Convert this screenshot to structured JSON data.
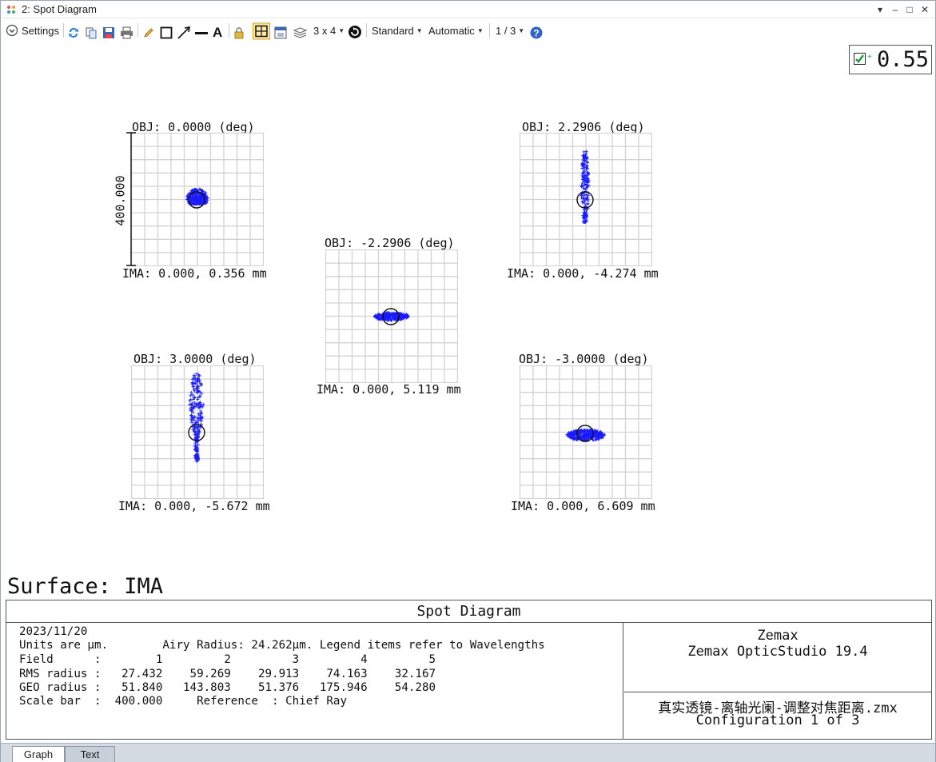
{
  "window": {
    "title": "2: Spot Diagram",
    "controls": [
      "▾",
      "–",
      "□",
      "✕"
    ]
  },
  "toolbar": {
    "settings_label": "Settings",
    "layout_label": "3 x 4",
    "standard_label": "Standard",
    "automatic_label": "Automatic",
    "page_label": "1 / 3"
  },
  "value_box": {
    "value": "0.55"
  },
  "surface_label": "Surface: IMA",
  "scale_bar_label": "400.000",
  "fields": [
    {
      "obj": "OBJ: 0.0000 (deg)",
      "ima": "IMA: 0.000, 0.356 mm",
      "spot": "blob"
    },
    {
      "obj": "OBJ: 2.2906 (deg)",
      "ima": "IMA: 0.000, -4.274 mm",
      "spot": "vertical"
    },
    {
      "obj": "OBJ: -2.2906 (deg)",
      "ima": "IMA: 0.000, 5.119 mm",
      "spot": "horizontal"
    },
    {
      "obj": "OBJ: 3.0000 (deg)",
      "ima": "IMA: 0.000, -5.672 mm",
      "spot": "vertical-long"
    },
    {
      "obj": "OBJ: -3.0000 (deg)",
      "ima": "IMA: 0.000, 6.609 mm",
      "spot": "horizontal-wide"
    }
  ],
  "info": {
    "title": "Spot Diagram",
    "date": "2023/11/20",
    "units_line": "Units are µm.        Airy Radius: 24.262µm. Legend items refer to Wavelengths",
    "field_line": "Field      :        1         2         3         4         5",
    "rms_line": "RMS radius :   27.432    59.269    29.913    74.163    32.167",
    "geo_line": "GEO radius :   51.840   143.803    51.376   175.946    54.280",
    "scale_line": "Scale bar  :  400.000     Reference  : Chief Ray",
    "company": "Zemax",
    "product": "Zemax OpticStudio 19.4",
    "filename": "真实透镜-离轴光阑-调整对焦距离.zmx",
    "configuration": "Configuration 1 of 3"
  },
  "tabs": [
    "Graph",
    "Text"
  ],
  "colors": {
    "spot": "#1a1aff",
    "grid": "#d2d2d2",
    "check": "#1f9a3e",
    "help": "#2f63c8"
  }
}
